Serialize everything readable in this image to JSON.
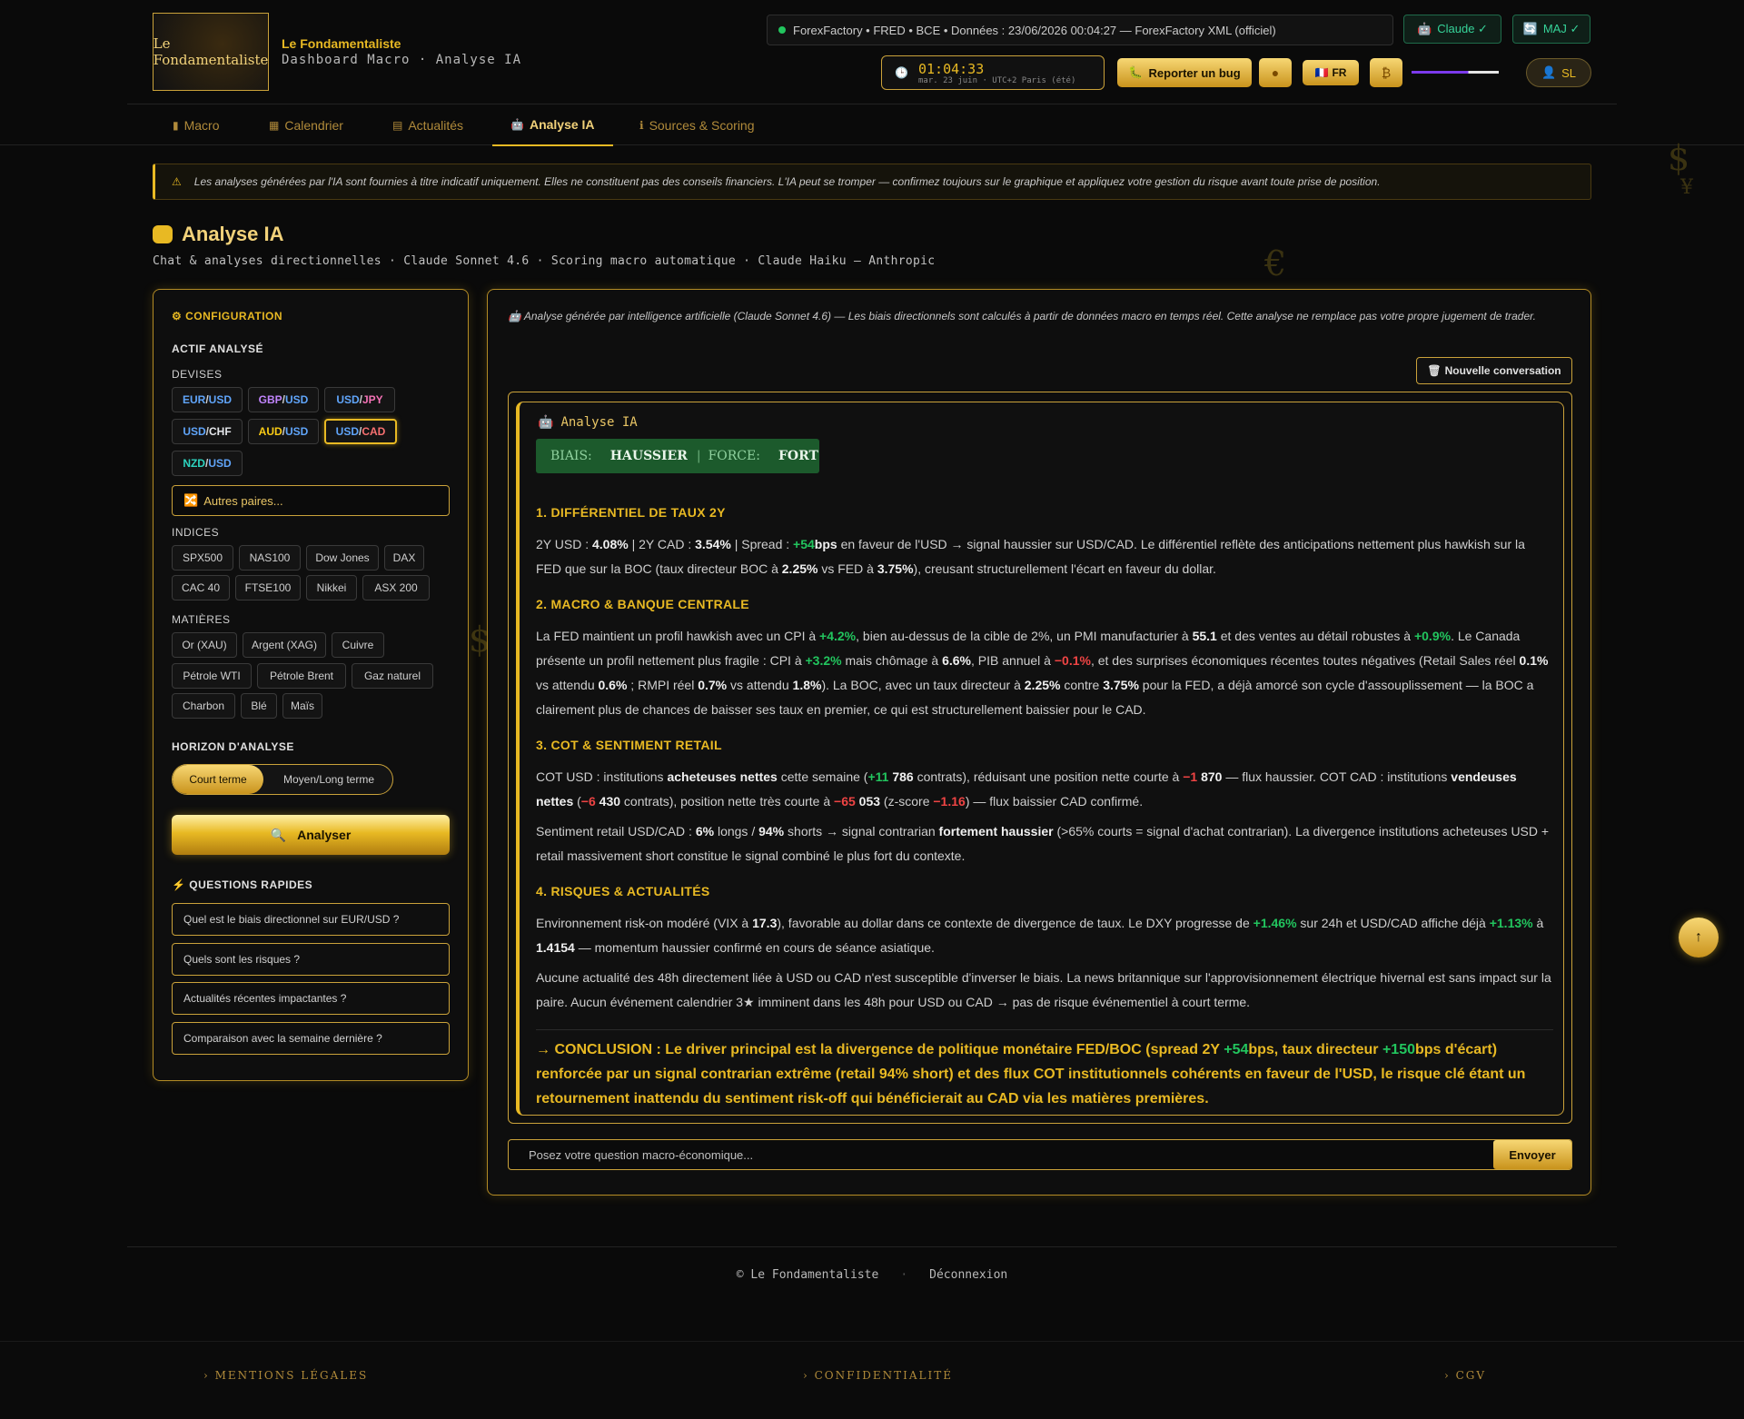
{
  "brand": {
    "logo_text": "Le Fondamentaliste",
    "title": "Le Fondamentaliste",
    "subtitle": "Dashboard Macro · Analyse IA"
  },
  "status_bar": {
    "text": "ForexFactory • FRED • BCE • Données : 23/06/2026 00:04:27 — ForexFactory XML (officiel)"
  },
  "header": {
    "claude_badge": "Claude ✓",
    "maj_badge": "MAJ ✓",
    "clock_time": "01:04:33",
    "clock_date": "mar. 23 juin · UTC+2 Paris (été)",
    "bug_button": "Reporter un bug",
    "lang_button": "FR",
    "user_initials": "SL"
  },
  "tabs": [
    {
      "label": "Macro"
    },
    {
      "label": "Calendrier"
    },
    {
      "label": "Actualités"
    },
    {
      "label": "Analyse IA"
    },
    {
      "label": "Sources & Scoring"
    }
  ],
  "warning": "Les analyses générées par l'IA sont fournies à titre indicatif uniquement. Elles ne constituent pas des conseils financiers. L'IA peut se tromper — confirmez toujours sur le graphique et appliquez votre gestion du risque avant toute prise de position.",
  "page": {
    "title": "Analyse IA",
    "subtitle": "Chat & analyses directionnelles · Claude Sonnet 4.6 · Scoring macro automatique · Claude Haiku — Anthropic"
  },
  "config": {
    "title": "CONFIGURATION",
    "asset_label": "ACTIF ANALYSÉ",
    "currencies_label": "DEVISES",
    "currencies": [
      {
        "base": "EUR",
        "quote": "USD"
      },
      {
        "base": "GBP",
        "quote": "USD"
      },
      {
        "base": "USD",
        "quote": "JPY"
      },
      {
        "base": "USD",
        "quote": "CHF"
      },
      {
        "base": "AUD",
        "quote": "USD"
      },
      {
        "base": "USD",
        "quote": "CAD"
      },
      {
        "base": "NZD",
        "quote": "USD"
      }
    ],
    "selected_pair": "USD/CAD",
    "other_pairs": "Autres paires...",
    "indices_label": "INDICES",
    "indices": [
      "SPX500",
      "NAS100",
      "Dow Jones",
      "DAX",
      "CAC 40",
      "FTSE100",
      "Nikkei",
      "ASX 200"
    ],
    "commodities_label": "MATIÈRES",
    "commodities": [
      "Or (XAU)",
      "Argent (XAG)",
      "Cuivre",
      "Pétrole WTI",
      "Pétrole Brent",
      "Gaz naturel",
      "Charbon",
      "Blé",
      "Maïs"
    ],
    "horizon_label": "HORIZON D'ANALYSE",
    "horizon_short": "Court terme",
    "horizon_long": "Moyen/Long terme",
    "analyse_button": "Analyser",
    "quick_label": "QUESTIONS RAPIDES",
    "quick_questions": [
      "Quel est le biais directionnel sur EUR/USD ?",
      "Quels sont les risques ?",
      "Actualités récentes impactantes ?",
      "Comparaison avec la semaine dernière ?"
    ]
  },
  "chat": {
    "notice": "Analyse générée par intelligence artificielle (Claude Sonnet 4.6) — Les biais directionnels sont calculés à partir de données macro en temps réel. Cette analyse ne remplace pas votre propre jugement de trader.",
    "new_conversation": "Nouvelle conversation",
    "answer_header": "Analyse IA",
    "bias_label": "BIAIS:",
    "bias_value": "HAUSSIER",
    "force_label": "FORCE:",
    "force_value": "FORT",
    "input_placeholder": "Posez votre question macro-économique...",
    "send_button": "Envoyer"
  },
  "analysis": {
    "s1_title": "1. DIFFÉRENTIEL DE TAUX 2Y",
    "s1": {
      "a": "2Y USD : ",
      "usd2y": "4.08%",
      "b": " | 2Y CAD : ",
      "cad2y": "3.54%",
      "c": " | Spread : ",
      "spread": "+54",
      "d": "bps",
      "e": " en faveur de l'USD → signal haussier sur USD/CAD. Le différentiel reflète des anticipations nettement plus hawkish sur la FED que sur la BOC (taux directeur BOC à ",
      "boc": "2.25%",
      "f": " vs FED à ",
      "fed": "3.75%",
      "g": "), creusant structurellement l'écart en faveur du dollar."
    },
    "s2_title": "2. MACRO & BANQUE CENTRALE",
    "s2": {
      "a": "La FED maintient un profil hawkish avec un CPI à ",
      "cpi_us": "+4.2%",
      "b": ", bien au-dessus de la cible de 2%, un PMI manufacturier à ",
      "pmi": "55.1",
      "c": " et des ventes au détail robustes à ",
      "retail": "+0.9%",
      "d": ". Le Canada présente un profil nettement plus fragile : CPI à ",
      "cpi_ca": "+3.2%",
      "e": " mais chômage à ",
      "unemp": "6.6%",
      "f": ", PIB annuel à ",
      "gdp": "−0.1%",
      "g": ", et des surprises économiques récentes toutes négatives (Retail Sales réel ",
      "rs_real": "0.1%",
      "h": " vs attendu ",
      "rs_exp": "0.6%",
      "i": " ; RMPI réel ",
      "rmpi_real": "0.7%",
      "j": " vs attendu ",
      "rmpi_exp": "1.8%",
      "k": "). La BOC, avec un taux directeur à ",
      "boc": "2.25%",
      "l": " contre ",
      "fed": "3.75%",
      "m": " pour la FED, a déjà amorcé son cycle d'assouplissement — la BOC a clairement plus de chances de baisser ses taux en premier, ce qui est structurellement baissier pour le CAD."
    },
    "s3_title": "3. COT & SENTIMENT RETAIL",
    "s3": {
      "a": "COT USD : institutions ",
      "buyers": "acheteuses nettes",
      "b": " cette semaine (",
      "usd_chg": "+11",
      "usd_chg2": " 786",
      "c": " contrats), réduisant une position nette courte à ",
      "usd_net": "−1",
      "usd_net2": " 870",
      "d": " — flux haussier. COT CAD : institutions ",
      "sellers": "vendeuses nettes",
      "e": " (",
      "cad_chg": "−6",
      "cad_chg2": " 430",
      "f": " contrats), position nette très courte à ",
      "cad_net": "−65",
      "cad_net2": " 053",
      "g": " (z-score ",
      "z": "−1.16",
      "h": ") — flux baissier CAD confirmé."
    },
    "s3b": {
      "a": "Sentiment retail USD/CAD : ",
      "longs": "6%",
      "b": " longs / ",
      "shorts": "94%",
      "c": " shorts → signal contrarian ",
      "strong": "fortement haussier",
      "d": " (>65% courts = signal d'achat contrarian). La divergence institutions acheteuses USD + retail massivement short constitue le signal combiné le plus fort du contexte."
    },
    "s4_title": "4. RISQUES & ACTUALITÉS",
    "s4": {
      "a": "Environnement risk-on modéré (VIX à ",
      "vix": "17.3",
      "b": "), favorable au dollar dans ce contexte de divergence de taux. Le DXY progresse de ",
      "dxy": "+1.46%",
      "c": " sur 24h et USD/CAD affiche déjà ",
      "usdcad_chg": "+1.13%",
      "d": " à ",
      "usdcad": "1.4154",
      "e": " — momentum haussier confirmé en cours de séance asiatique."
    },
    "s4b": "Aucune actualité des 48h directement liée à USD ou CAD n'est susceptible d'inverser le biais. La news britannique sur l'approvisionnement électrique hivernal est sans impact sur la paire. Aucun événement calendrier 3★ imminent dans les 48h pour USD ou CAD → pas de risque événementiel à court terme.",
    "conclusion": {
      "a": "→ CONCLUSION : Le driver principal est la divergence de politique monétaire FED/BOC (spread 2Y ",
      "spread": "+54",
      "b": "bps, taux directeur ",
      "diff": "+150",
      "c": "bps d'écart) renforcée par un signal contrarian extrême (retail 94% short) et des flux COT institutionnels cohérents en faveur de l'USD, le risque clé étant un retournement inattendu du sentiment risk-off qui bénéficierait au CAD via les matières premières."
    }
  },
  "footer": {
    "copyright": "© Le Fondamentaliste",
    "sep": "·",
    "logout": "Déconnexion"
  },
  "legal": {
    "mentions": "› MENTIONS LÉGALES",
    "privacy": "› CONFIDENTIALITÉ",
    "cgv": "› CGV"
  },
  "deco_symbols": [
    "$",
    "¥",
    "€",
    "£",
    "$",
    "€",
    "£"
  ]
}
